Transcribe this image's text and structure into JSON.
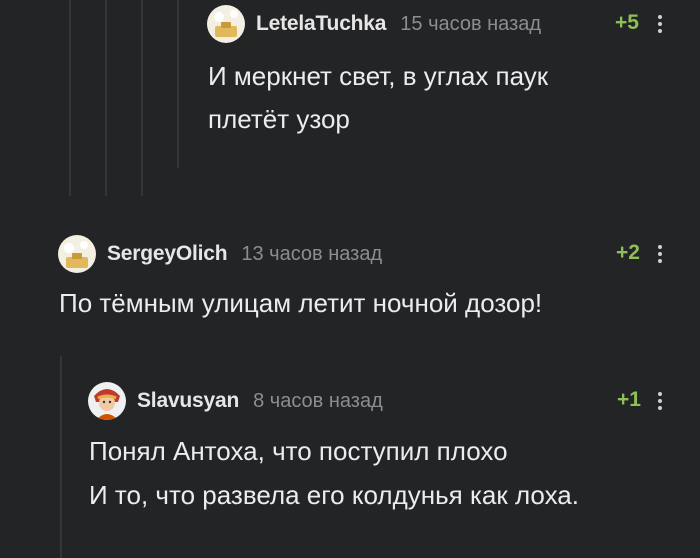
{
  "comments": [
    {
      "username": "LetelaTuchka",
      "time": "15 часов назад",
      "rating": "+5",
      "avatar": "default-avatar",
      "lines": [
        "И меркнет свет, в углах паук",
        "плетёт узор"
      ]
    },
    {
      "username": "SergeyOlich",
      "time": "13 часов назад",
      "rating": "+2",
      "avatar": "default-avatar",
      "lines": [
        "По тёмным улицам летит ночной дозор!"
      ]
    },
    {
      "username": "Slavusyan",
      "time": "8 часов назад",
      "rating": "+1",
      "avatar": "character-avatar",
      "lines": [
        "Понял Антоха, что поступил плохо",
        "И то, что развела его колдунья как лоха."
      ]
    }
  ],
  "colors": {
    "background": "#232426",
    "thread_line": "#34363a",
    "rating": "#8fbf57",
    "username": "#e6e6e6",
    "time": "#8d8d8d",
    "text": "#ececec"
  }
}
